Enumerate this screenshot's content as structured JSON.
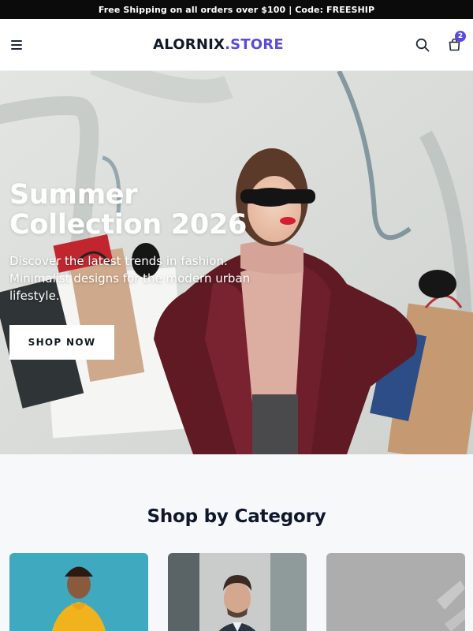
{
  "announcement": {
    "text": "Free Shipping on all orders over $100 | Code: FREESHIP"
  },
  "header": {
    "menu_icon": "hamburger-menu-icon",
    "logo_main": "ALORNIX",
    "logo_accent": ".STORE",
    "search_icon": "search-icon",
    "cart_icon": "shopping-bag-icon",
    "cart_count": "2"
  },
  "hero": {
    "title_line1": "Summer",
    "title_line2": "Collection 2026",
    "subtitle": "Discover the latest trends in fashion. Minimalist designs for the modern urban lifestyle.",
    "cta_label": "SHOP NOW"
  },
  "categories": {
    "title": "Shop by Category",
    "items": [
      {
        "image": "woman-yellow-hoodie-photo"
      },
      {
        "image": "man-portrait-photo"
      },
      {
        "image": "accessories-photo"
      }
    ]
  },
  "colors": {
    "accent": "#5b4bdb",
    "announcement_bg": "#0b0b0b",
    "page_bg": "#f7f8fa"
  }
}
